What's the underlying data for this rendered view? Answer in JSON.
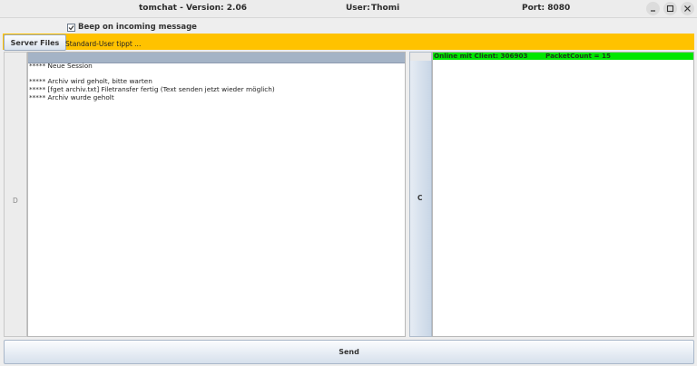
{
  "window": {
    "title": "tomchat - Version: 2.06",
    "user_label": "User:",
    "user_value": "Thomi",
    "port_label": "Port: 8080",
    "controls": [
      "minimize-icon",
      "maximize-icon",
      "close-icon"
    ]
  },
  "beep": {
    "label": "Beep on incoming message",
    "checked": true
  },
  "toolbar": {
    "server_files_label": "Server Files",
    "typing_status": "Standard-User tippt ..."
  },
  "left_strip": {
    "label": "D"
  },
  "chat": {
    "lines": [
      "***** Neue Session",
      "",
      "***** Archiv wird geholt, bitte warten",
      "***** [fget archiv.txt] Filetransfer fertig (Text senden jetzt wieder möglich)",
      "***** Archiv wurde geholt"
    ]
  },
  "right_strip": {
    "label": "C"
  },
  "clients": {
    "online_text": "Online mit Client: 306903",
    "packet_text": "PacketCount = 15"
  },
  "send": {
    "label": "Send"
  },
  "colors": {
    "yellow_bar": "#ffc200",
    "green_bar": "#00e600",
    "chat_header": "#a4b3c6"
  }
}
